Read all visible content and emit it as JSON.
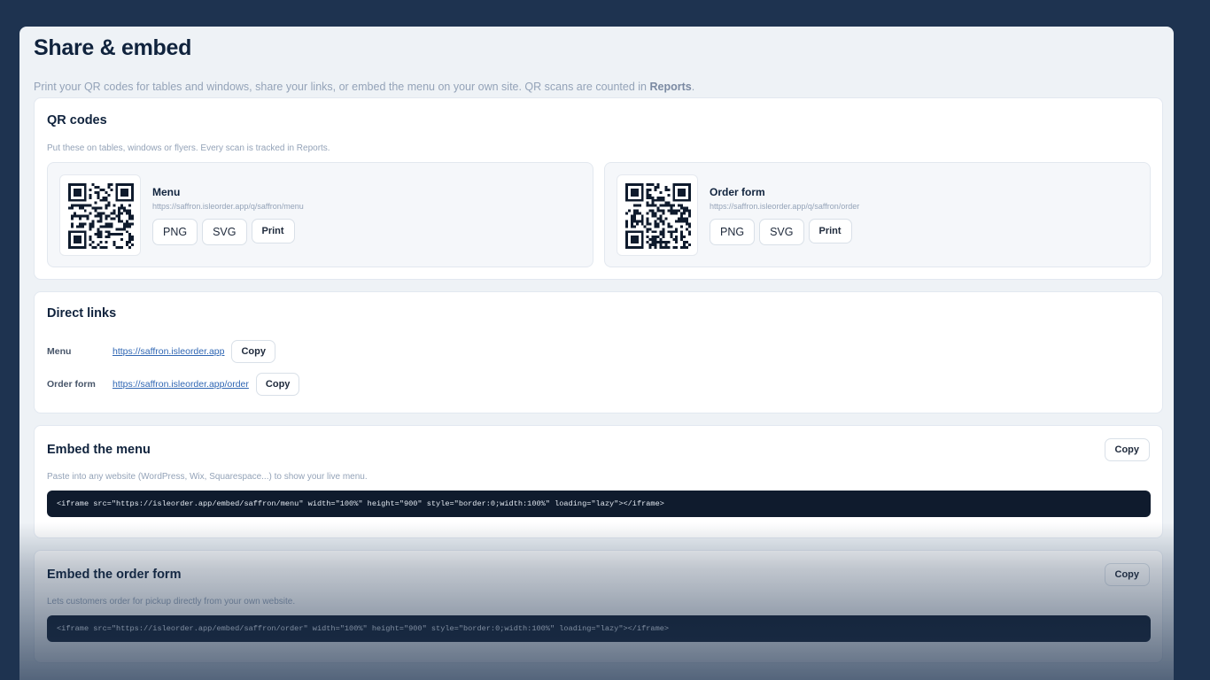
{
  "header": {
    "title": "Share & embed",
    "subtitle_prefix": "Print your QR codes for tables and windows, share your links, or embed the menu on your own site. QR scans are counted in ",
    "subtitle_link": "Reports",
    "subtitle_suffix": "."
  },
  "qr_section": {
    "title": "QR codes",
    "subtitle": "Put these on tables, windows or flyers. Every scan is tracked in Reports.",
    "items": [
      {
        "name": "Menu",
        "url": "https://saffron.isleorder.app/q/saffron/menu",
        "buttons": [
          "PNG",
          "SVG",
          "Print"
        ]
      },
      {
        "name": "Order form",
        "url": "https://saffron.isleorder.app/q/saffron/order",
        "buttons": [
          "PNG",
          "SVG",
          "Print"
        ]
      }
    ]
  },
  "direct_links": {
    "title": "Direct links",
    "rows": [
      {
        "label": "Menu",
        "url": "https://saffron.isleorder.app",
        "copy": "Copy"
      },
      {
        "label": "Order form",
        "url": "https://saffron.isleorder.app/order",
        "copy": "Copy"
      }
    ]
  },
  "embeds": [
    {
      "title": "Embed the menu",
      "subtitle": "Paste into any website (WordPress, Wix, Squarespace...) to show your live menu.",
      "copy": "Copy",
      "code": "<iframe src=\"https://isleorder.app/embed/saffron/menu\" width=\"100%\" height=\"900\" style=\"border:0;width:100%\" loading=\"lazy\"></iframe>"
    },
    {
      "title": "Embed the order form",
      "subtitle": "Lets customers order for pickup directly from your own website.",
      "copy": "Copy",
      "code": "<iframe src=\"https://isleorder.app/embed/saffron/order\" width=\"100%\" height=\"900\" style=\"border:0;width:100%\" loading=\"lazy\"></iframe>"
    }
  ],
  "colors": {
    "backdrop": "#1e3350",
    "page": "#eef2f6",
    "card": "#ffffff",
    "link": "#2f66b3",
    "code_bg": "#0f1b2d"
  }
}
